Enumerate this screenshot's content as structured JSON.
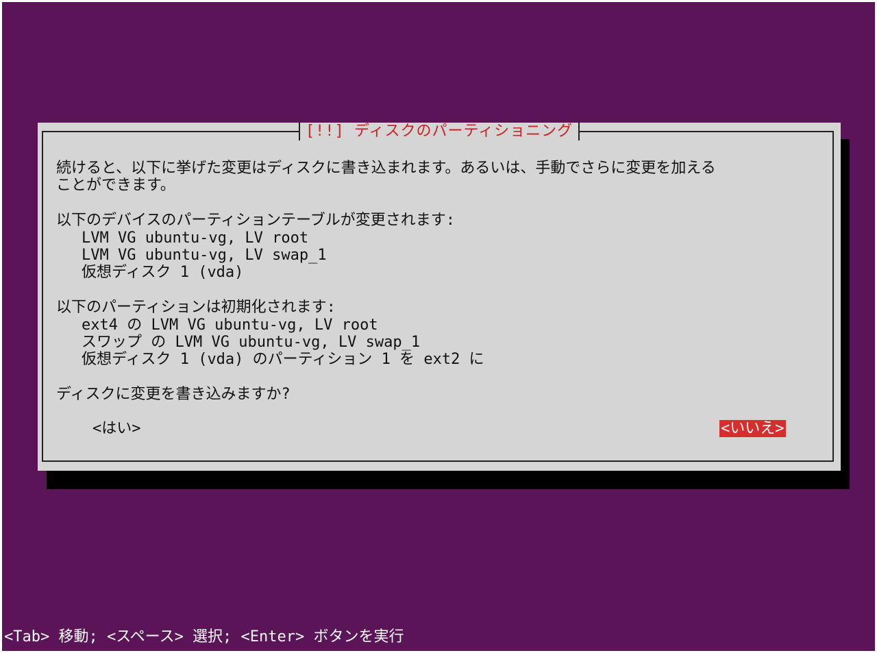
{
  "dialog": {
    "title": "[!!] ディスクのパーティショニング",
    "intro_line1": "続けると、以下に挙げた変更はディスクに書き込まれます。あるいは、手動でさらに変更を加える",
    "intro_line2": "ことができます。",
    "tables_heading": "以下のデバイスのパーティションテーブルが変更されます:",
    "tables": [
      "LVM VG ubuntu-vg, LV root",
      "LVM VG ubuntu-vg, LV swap_1",
      "仮想ディスク 1 (vda)"
    ],
    "format_heading": "以下のパーティションは初期化されます:",
    "formats": [
      "ext4 の LVM VG ubuntu-vg, LV root",
      "スワップ の LVM VG ubuntu-vg, LV swap_1",
      "仮想ディスク 1 (vda) のパーティション 1 を ext2 に"
    ],
    "question": "ディスクに変更を書き込みますか?",
    "yes_label": "<はい>",
    "no_label": "<いいえ>"
  },
  "help": {
    "text": "<Tab> 移動; <スペース> 選択; <Enter> ボタンを実行"
  },
  "colors": {
    "background": "#5c1459",
    "dialog": "#d5d5d5",
    "accent": "#d62e2e"
  }
}
